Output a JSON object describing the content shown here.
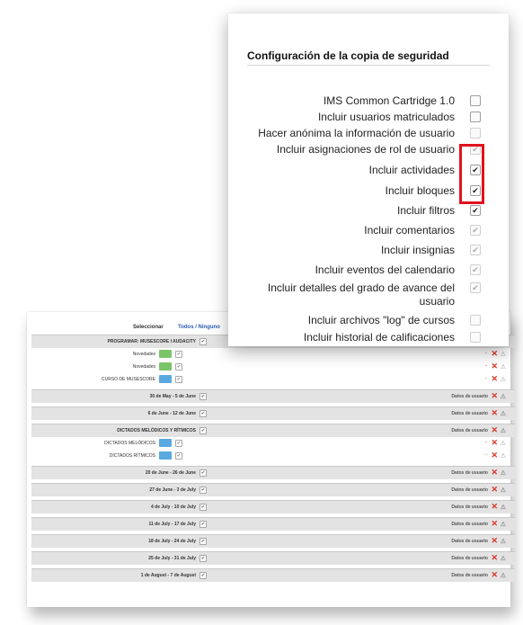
{
  "settings": {
    "title": "Configuración de la copia de seguridad",
    "options": [
      {
        "label": "IMS Common Cartridge 1.0",
        "checked": false,
        "disabled": false
      },
      {
        "label": "Incluir usuarios matriculados",
        "checked": false,
        "disabled": false
      },
      {
        "label": "Hacer anónima la información de usuario",
        "checked": false,
        "disabled": true
      },
      {
        "label": "Incluir asignaciones de rol de usuario",
        "checked": true,
        "disabled": true
      },
      {
        "label": "Incluir actividades",
        "checked": true,
        "disabled": false
      },
      {
        "label": "Incluir bloques",
        "checked": true,
        "disabled": false
      },
      {
        "label": "Incluir filtros",
        "checked": true,
        "disabled": false
      },
      {
        "label": "Incluir comentarios",
        "checked": true,
        "disabled": true
      },
      {
        "label": "Incluir insignias",
        "checked": true,
        "disabled": true
      },
      {
        "label": "Incluir eventos del calendario",
        "checked": true,
        "disabled": true
      },
      {
        "label": "Incluir detalles del grado de avance del usuario",
        "checked": true,
        "disabled": true
      },
      {
        "label": "Incluir archivos \"log\" de cursos",
        "checked": false,
        "disabled": true
      },
      {
        "label": "Incluir historial de calificaciones",
        "checked": false,
        "disabled": true
      }
    ],
    "highlight_color": "#e0121f"
  },
  "sections": {
    "select_label": "Seleccionar",
    "select_links": "Todos / Ninguno",
    "user_data_label": "Datos de usuario",
    "rows": [
      {
        "text": "PROGRAMAR: MUSESCORE I AUDACITY",
        "type": "hdr",
        "ud": true
      },
      {
        "text": "Novedades",
        "type": "item",
        "icon": "green"
      },
      {
        "text": "Novedades",
        "type": "item",
        "icon": "green"
      },
      {
        "text": "CURSO DE MUSESCORE",
        "type": "item",
        "icon": "blue"
      },
      {
        "text": "30 de May - 5 de June",
        "type": "hdr",
        "ud": true
      },
      {
        "text": "6 de June - 12 de June",
        "type": "hdr",
        "ud": true
      },
      {
        "text": "DICTADOS MELÓDICOS Y RÍTMICOS",
        "type": "hdr",
        "ud": true
      },
      {
        "text": "DICTADOS MELÓDICOS",
        "type": "item",
        "icon": "blue"
      },
      {
        "text": "DICTADOS RÍTMICOS",
        "type": "item",
        "icon": "blue"
      },
      {
        "text": "20 de June - 26 de June",
        "type": "hdr",
        "ud": true
      },
      {
        "text": "27 de June - 3 de July",
        "type": "hdr",
        "ud": true
      },
      {
        "text": "4 de July - 10 de July",
        "type": "hdr",
        "ud": true
      },
      {
        "text": "11 de July - 17 de July",
        "type": "hdr",
        "ud": true
      },
      {
        "text": "18 de July - 24 de July",
        "type": "hdr",
        "ud": true
      },
      {
        "text": "25 de July - 31 de July",
        "type": "hdr",
        "ud": true
      },
      {
        "text": "1 de August - 7 de August",
        "type": "hdr",
        "ud": true
      }
    ]
  }
}
